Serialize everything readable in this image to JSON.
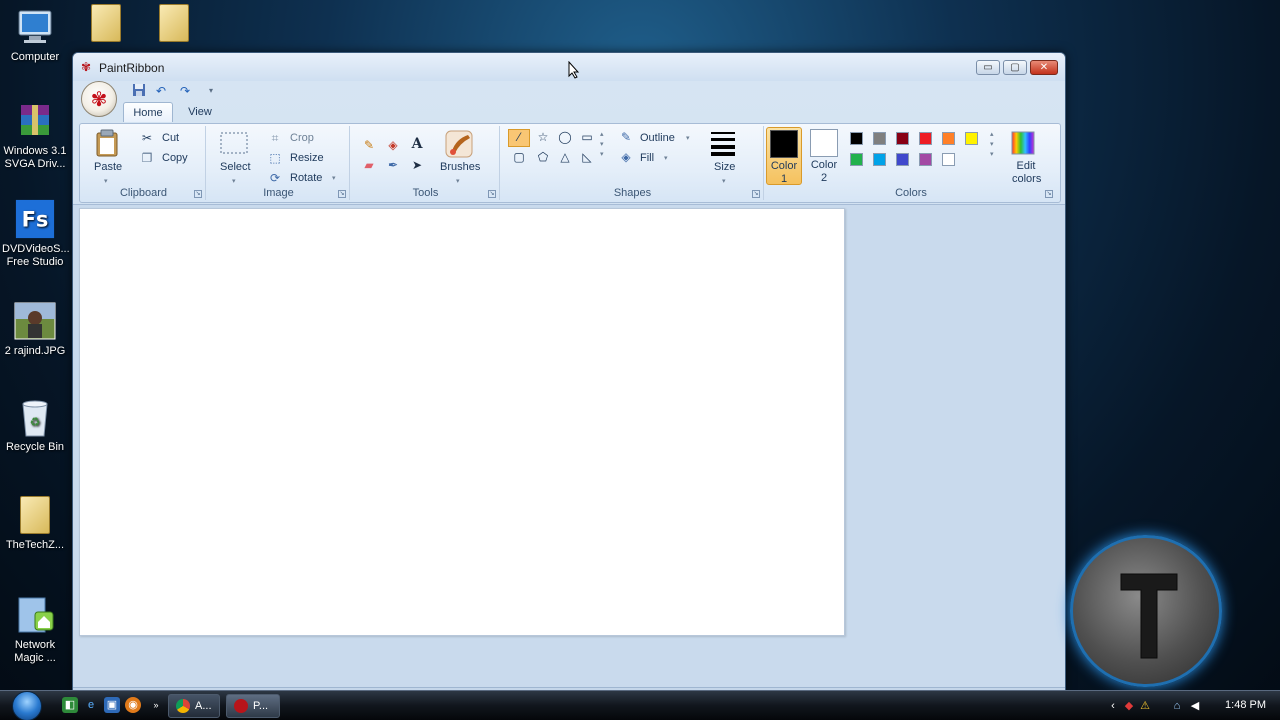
{
  "desktop": {
    "icons": [
      {
        "label": "Computer"
      },
      {
        "label": "Windows 3.1\nSVGA Driv..."
      },
      {
        "label": "DVDVideoS...\nFree Studio"
      },
      {
        "label": "2 rajind.JPG"
      },
      {
        "label": "Recycle Bin"
      },
      {
        "label": "TheTechZ..."
      },
      {
        "label": "Network\nMagic ..."
      }
    ]
  },
  "window": {
    "title": "PaintRibbon",
    "controls": {
      "minimize": "▭",
      "maximize": "▢",
      "close": "✕"
    }
  },
  "ribbon": {
    "tabs": [
      {
        "label": "Home"
      },
      {
        "label": "View"
      }
    ],
    "groups": {
      "clipboard": {
        "label": "Clipboard",
        "paste": "Paste",
        "cut": "Cut",
        "copy": "Copy"
      },
      "image": {
        "label": "Image",
        "select": "Select",
        "crop": "Crop",
        "resize": "Resize",
        "rotate": "Rotate"
      },
      "tools": {
        "label": "Tools",
        "brushes": "Brushes"
      },
      "shapes": {
        "label": "Shapes",
        "outline": "Outline",
        "fill": "Fill",
        "size": "Size"
      },
      "colors": {
        "label": "Colors",
        "color1": "Color 1",
        "color2": "Color 2",
        "edit_colors": "Edit colors",
        "color1_value": "#000000",
        "color2_value": "#ffffff",
        "palette_row1": [
          "#000000",
          "#7f7f7f",
          "#880015",
          "#ed1c24",
          "#ff7f27",
          "#fff200"
        ],
        "palette_row2": [
          "#22b14c",
          "#00a2e8",
          "#3f48cc",
          "#a349a4",
          "#ffffff"
        ]
      }
    }
  },
  "taskbar": {
    "buttons": [
      {
        "label": "A..."
      },
      {
        "label": "P..."
      }
    ],
    "clock": "1:48 PM"
  },
  "watermark": {
    "letter": "T"
  }
}
